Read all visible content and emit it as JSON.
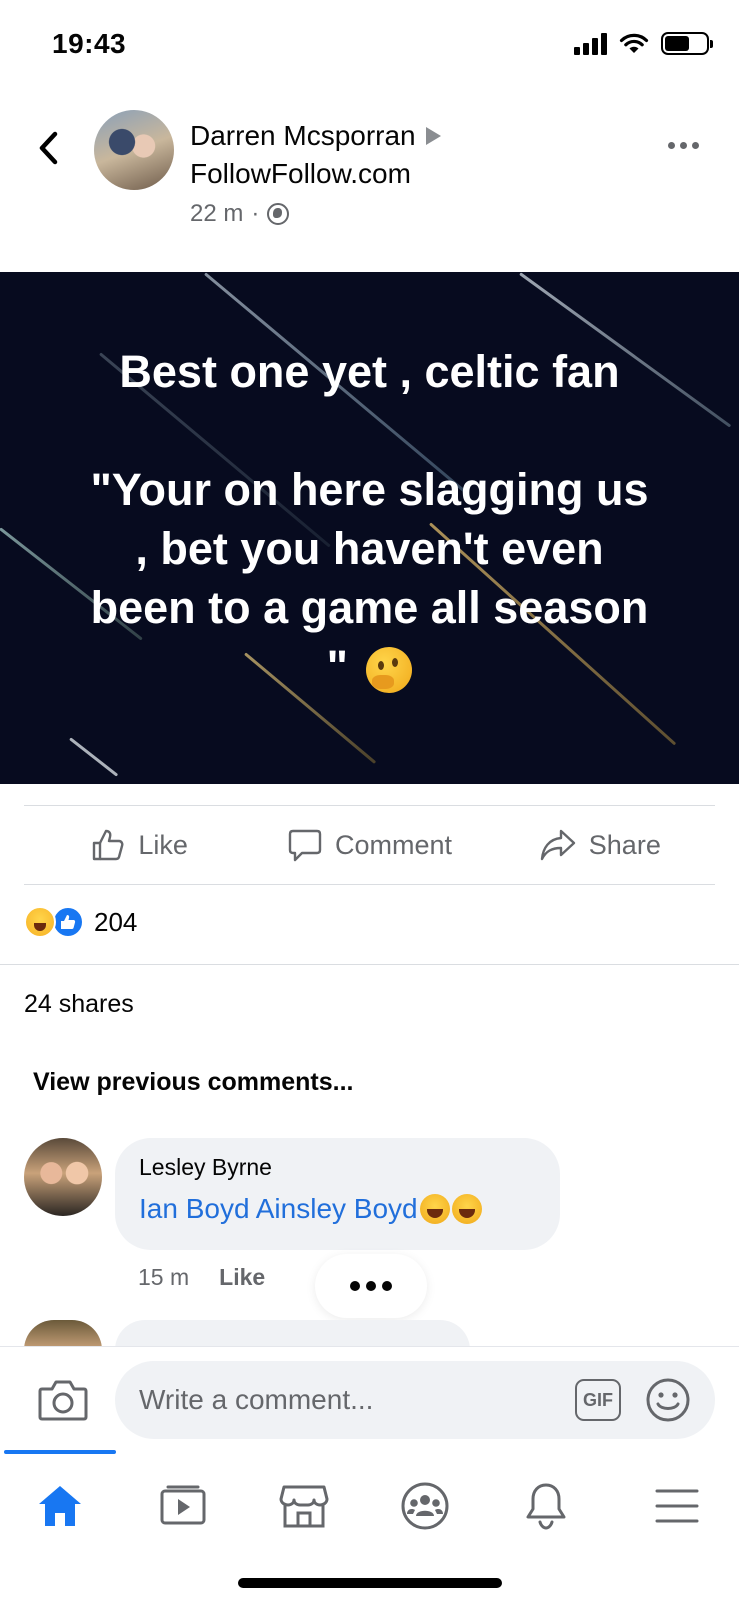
{
  "status_bar": {
    "time": "19:43"
  },
  "post": {
    "author": "Darren Mcsporran",
    "group": "FollowFollow.com",
    "time": "22 m",
    "meta_separator": "·",
    "privacy_icon": "globe-icon",
    "image_text_lines": [
      "Best one yet , celtic fan",
      "\"Your on here slagging us",
      ", bet you haven't even",
      "been to a game all season",
      "\""
    ],
    "image_emoji": "thinking-face"
  },
  "actions": {
    "like_label": "Like",
    "comment_label": "Comment",
    "share_label": "Share"
  },
  "reactions": {
    "types": [
      "haha",
      "like"
    ],
    "count": "204"
  },
  "shares_text": "24 shares",
  "view_previous_label": "View previous comments...",
  "comments": [
    {
      "author": "Lesley Byrne",
      "mentions": "Ian Boyd Ainsley Boyd",
      "emojis": [
        "laughing-tears",
        "laughing-tears"
      ],
      "time": "15 m",
      "like_label": "Like"
    }
  ],
  "composer": {
    "placeholder": "Write a comment...",
    "gif_label": "GIF"
  },
  "bottom_nav": {
    "items": [
      "home-icon",
      "watch-icon",
      "marketplace-icon",
      "groups-icon",
      "notifications-icon",
      "menu-icon"
    ],
    "active": "home-icon"
  },
  "colors": {
    "brand_blue": "#1877f2",
    "mention_blue": "#216fdb",
    "secondary_text": "#65676b",
    "image_background": "#070b1f"
  }
}
